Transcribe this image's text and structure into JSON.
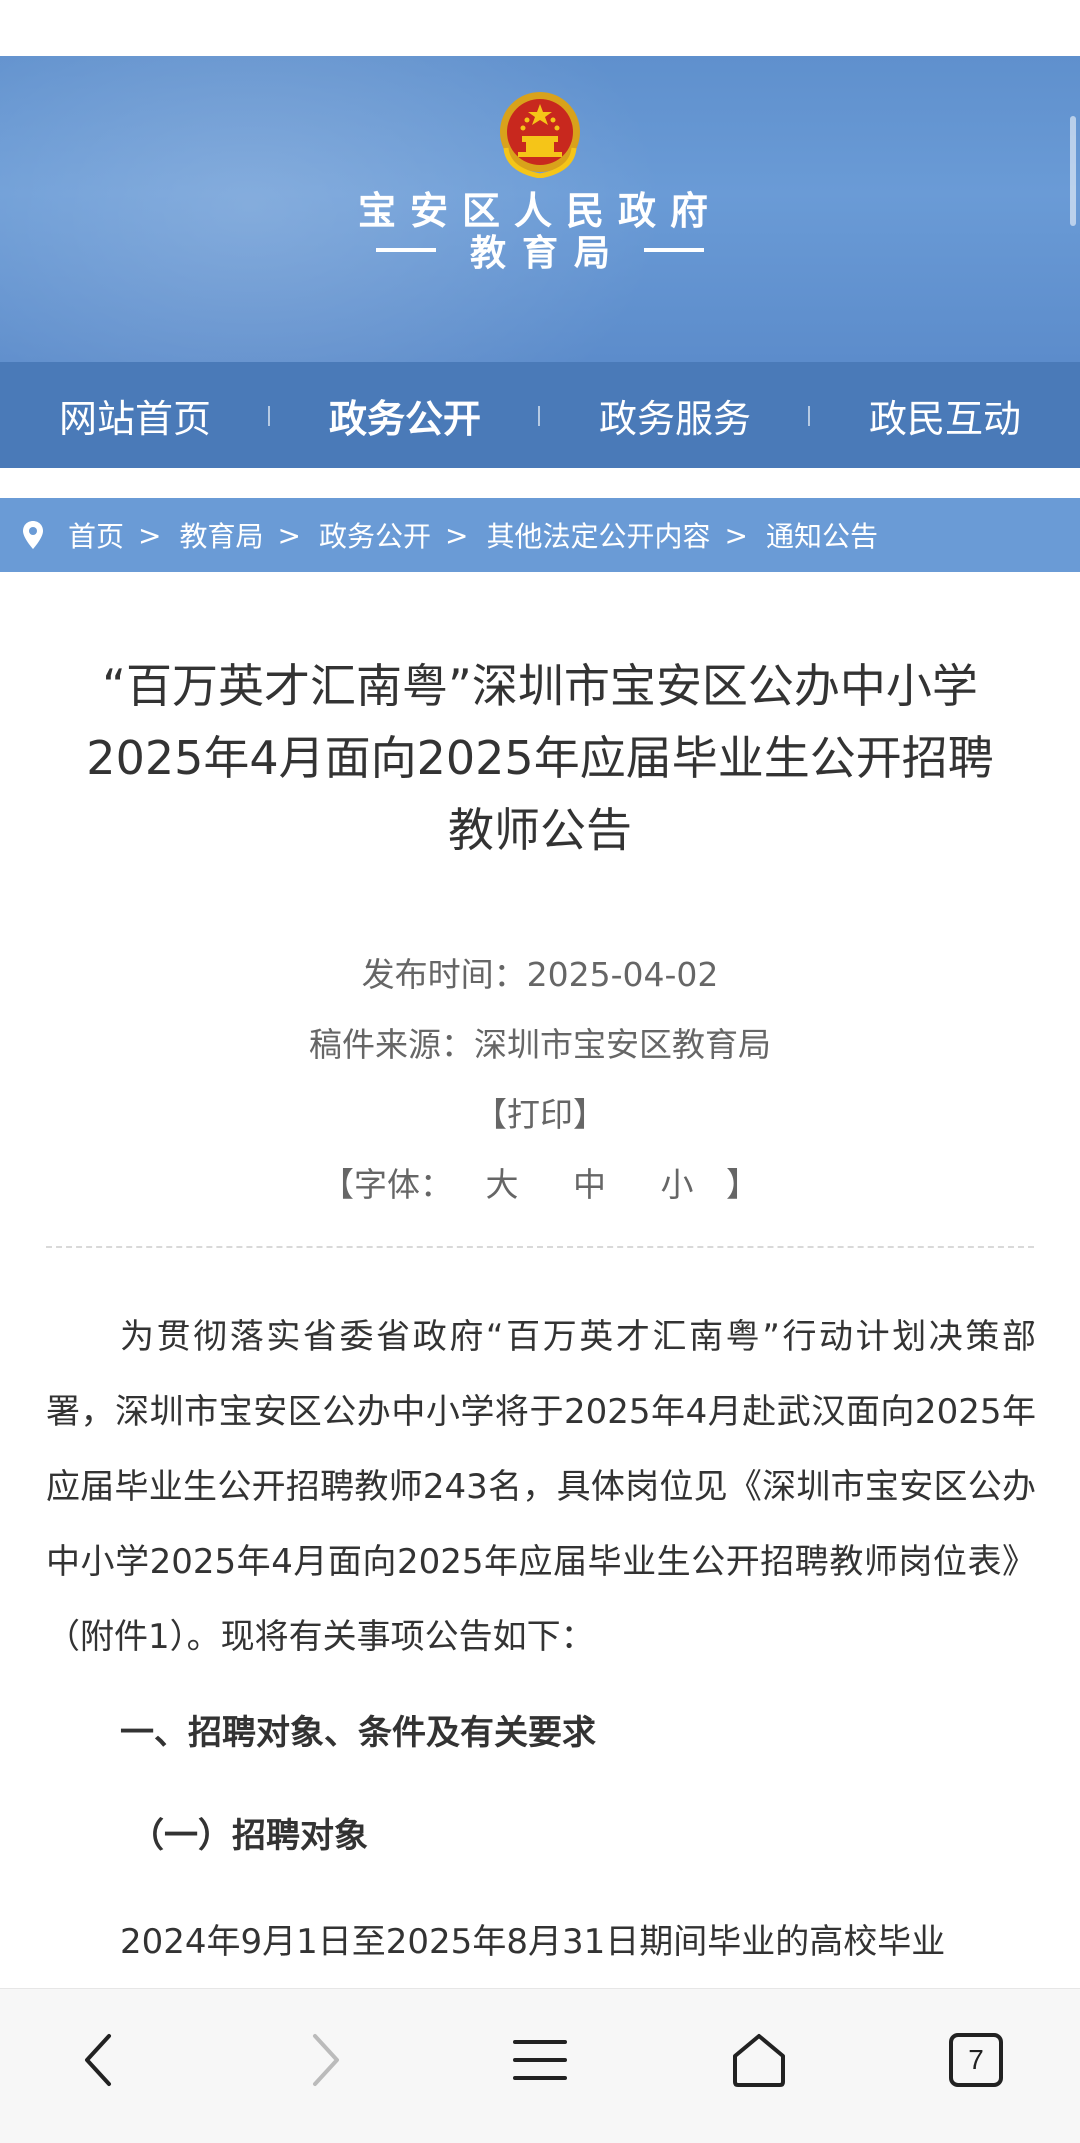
{
  "header": {
    "org_name": "宝安区人民政府",
    "bureau_name": "教育局"
  },
  "nav": {
    "items": [
      {
        "label": "网站首页",
        "active": false
      },
      {
        "label": "政务公开",
        "active": true
      },
      {
        "label": "政务服务",
        "active": false
      },
      {
        "label": "政民互动",
        "active": false
      }
    ]
  },
  "breadcrumb": {
    "items": [
      "首页",
      "教育局",
      "政务公开",
      "其他法定公开内容",
      "通知公告"
    ],
    "separator": ">"
  },
  "article": {
    "title_lines": [
      "“百万英才汇南粤”深圳市宝安区公办中小学",
      "2025年4月面向2025年应届毕业生公开招聘",
      "教师公告"
    ],
    "publish_label": "发布时间：",
    "publish_date": "2025-04-02",
    "source_label": "稿件来源：",
    "source": "深圳市宝安区教育局",
    "print_label": "【打印】",
    "font_label": "【字体：",
    "font_large": "大",
    "font_medium": "中",
    "font_small": "小",
    "font_close": "】",
    "intro": "为贯彻落实省委省政府“百万英才汇南粤”行动计划决策部署，深圳市宝安区公办中小学将于2025年4月赴武汉面向2025年应届毕业生公开招聘教师243名，具体岗位见《深圳市宝安区公办中小学2025年4月面向2025年应届毕业生公开招聘教师岗位表》（附件1）。现将有关事项公告如下：",
    "section1": "一、招聘对象、条件及有关要求",
    "section1_1": "（一）招聘对象",
    "body_line": "2024年9月1日至2025年8月31日期间毕业的高校毕业"
  },
  "browser": {
    "tab_count": "7"
  },
  "colors": {
    "banner": "#6a9bd6",
    "nav": "#4a7ab8",
    "breadcrumb": "#6a9bd6"
  }
}
